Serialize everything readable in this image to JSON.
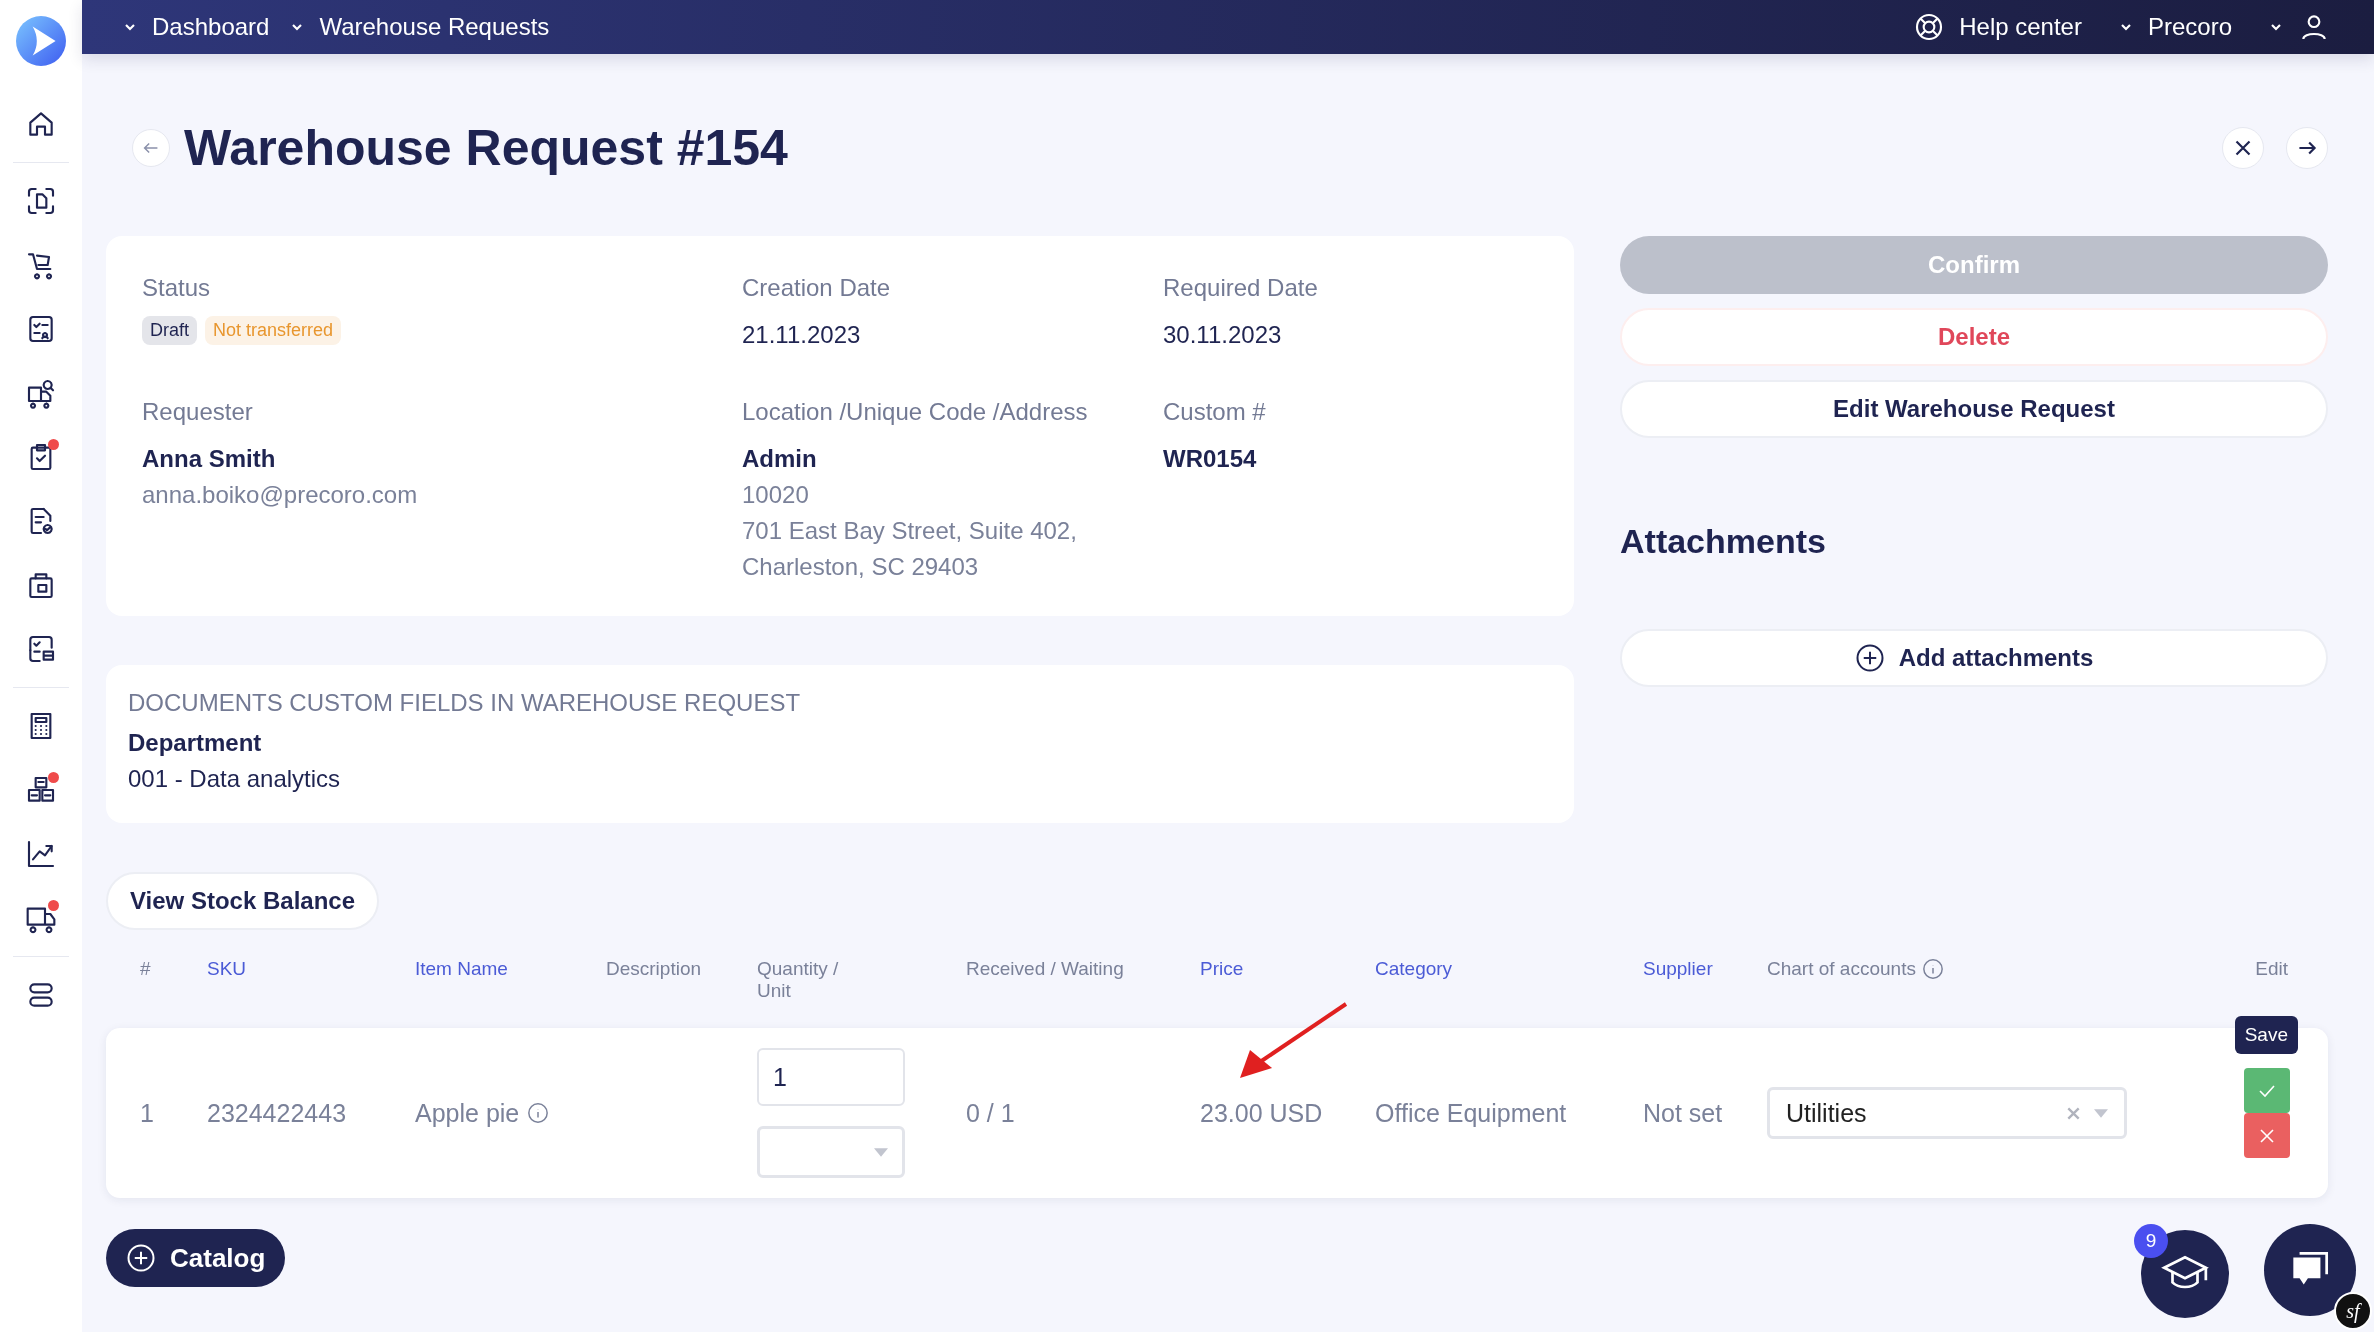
{
  "topbar": {
    "breadcrumbs": [
      "Dashboard",
      "Warehouse Requests"
    ],
    "help": "Help center",
    "company": "Precoro"
  },
  "sidebar": {
    "groups": [
      [
        {
          "badge": false
        }
      ],
      [
        {
          "badge": false
        },
        {
          "badge": false
        },
        {
          "badge": false
        },
        {
          "badge": false
        },
        {
          "badge": true
        },
        {
          "badge": false
        },
        {
          "badge": false
        },
        {
          "badge": false
        }
      ],
      [
        {
          "badge": false
        },
        {
          "badge": true
        },
        {
          "badge": false
        },
        {
          "badge": true
        }
      ],
      [
        {
          "badge": false
        }
      ]
    ]
  },
  "title": "Warehouse Request #154",
  "details": {
    "status_label": "Status",
    "statuses": [
      {
        "label": "Draft",
        "color": "#1f2451"
      },
      {
        "label": "Not transferred",
        "color": "#e8962e"
      }
    ],
    "fields": [
      {
        "label": "Creation Date",
        "lines": [
          {
            "text": "21.11.2023",
            "kind": "value"
          }
        ]
      },
      {
        "label": "Required Date",
        "lines": [
          {
            "text": "30.11.2023",
            "kind": "value"
          }
        ]
      },
      {
        "label": "Requester",
        "lines": [
          {
            "text": "Anna Smith",
            "kind": "name"
          },
          {
            "text": "anna.boiko@precoro.com",
            "kind": "muted"
          }
        ]
      },
      {
        "label": "Location /Unique Code /Address",
        "lines": [
          {
            "text": "Admin",
            "kind": "name"
          },
          {
            "text": "10020",
            "kind": "muted"
          },
          {
            "text": "701 East Bay Street, Suite 402,",
            "kind": "muted"
          },
          {
            "text": "Charleston, SC 29403",
            "kind": "muted"
          }
        ]
      },
      {
        "label": "Custom #",
        "lines": [
          {
            "text": "WR0154",
            "kind": "name"
          }
        ]
      }
    ]
  },
  "custom_fields": {
    "heading": "DOCUMENTS CUSTOM FIELDS IN WAREHOUSE REQUEST",
    "label": "Department",
    "value": "001 - Data analytics"
  },
  "actions": [
    {
      "label": "Confirm",
      "kind": "disabled"
    },
    {
      "label": "Delete",
      "kind": "danger"
    },
    {
      "label": "Edit Warehouse Request",
      "kind": "default"
    }
  ],
  "attachments": {
    "heading": "Attachments",
    "button": "Add attachments"
  },
  "stock_button": "View Stock Balance",
  "table": {
    "columns": [
      {
        "label": "#",
        "sortable": false,
        "info": false
      },
      {
        "label": "SKU",
        "sortable": true,
        "info": false
      },
      {
        "label": "Item Name",
        "sortable": true,
        "info": false
      },
      {
        "label": "Description",
        "sortable": false,
        "info": false
      },
      {
        "label": "Quantity / Unit",
        "sortable": false,
        "info": false
      },
      {
        "label": "Received / Waiting",
        "sortable": false,
        "info": false
      },
      {
        "label": "Price",
        "sortable": true,
        "info": false
      },
      {
        "label": "Category",
        "sortable": true,
        "info": false
      },
      {
        "label": "Supplier",
        "sortable": true,
        "info": false
      },
      {
        "label": "Chart of accounts",
        "sortable": false,
        "info": true
      },
      {
        "label": "Edit",
        "sortable": false,
        "info": false
      }
    ],
    "rows": [
      {
        "number": "1",
        "sku": "2324422443",
        "item_name": "Apple pie",
        "quantity": "1",
        "received": "0 / 1",
        "price": "23.00 USD",
        "category": "Office Equipment",
        "supplier": "Not set",
        "chart_of_accounts": "Utilities",
        "save_tooltip": "Save"
      }
    ]
  },
  "catalog_button": "Catalog",
  "academy_count": "9",
  "debug_badge": "sf"
}
